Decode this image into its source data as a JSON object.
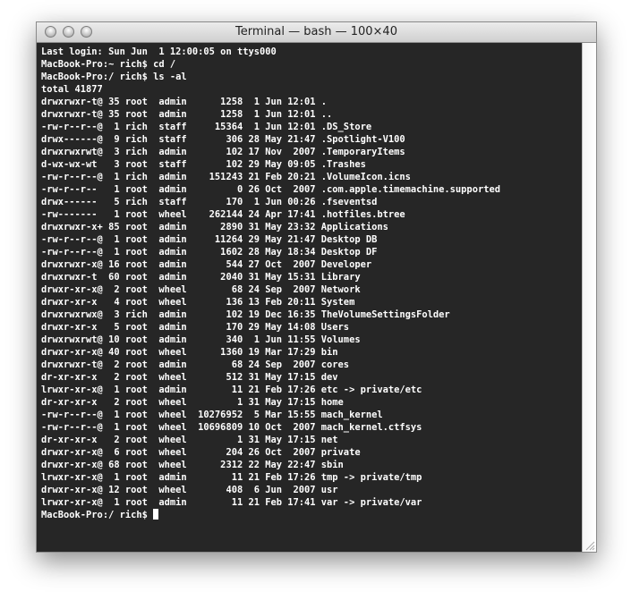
{
  "window": {
    "title": "Terminal — bash — 100×40"
  },
  "terminal": {
    "lines": [
      "Last login: Sun Jun  1 12:00:05 on ttys000",
      "MacBook-Pro:~ rich$ cd /",
      "MacBook-Pro:/ rich$ ls -al",
      "total 41877",
      "drwxrwxr-t@ 35 root  admin      1258  1 Jun 12:01 .",
      "drwxrwxr-t@ 35 root  admin      1258  1 Jun 12:01 ..",
      "-rw-r--r--@  1 rich  staff     15364  1 Jun 12:01 .DS_Store",
      "drwx------@  9 rich  staff       306 28 May 21:47 .Spotlight-V100",
      "drwxrwxrwt@  3 rich  admin       102 17 Nov  2007 .TemporaryItems",
      "d-wx-wx-wt   3 root  staff       102 29 May 09:05 .Trashes",
      "-rw-r--r--@  1 rich  admin    151243 21 Feb 20:21 .VolumeIcon.icns",
      "-rw-r--r--   1 root  admin         0 26 Oct  2007 .com.apple.timemachine.supported",
      "drwx------   5 rich  staff       170  1 Jun 00:26 .fseventsd",
      "-rw-------   1 root  wheel    262144 24 Apr 17:41 .hotfiles.btree",
      "drwxrwxr-x+ 85 root  admin      2890 31 May 23:32 Applications",
      "-rw-r--r--@  1 root  admin     11264 29 May 21:47 Desktop DB",
      "-rw-r--r--@  1 root  admin      1602 28 May 18:34 Desktop DF",
      "drwxrwxr-x@ 16 root  admin       544 27 Oct  2007 Developer",
      "drwxrwxr-t  60 root  admin      2040 31 May 15:31 Library",
      "drwxr-xr-x@  2 root  wheel        68 24 Sep  2007 Network",
      "drwxr-xr-x   4 root  wheel       136 13 Feb 20:11 System",
      "drwxrwxrwx@  3 rich  admin       102 19 Dec 16:35 TheVolumeSettingsFolder",
      "drwxr-xr-x   5 root  admin       170 29 May 14:08 Users",
      "drwxrwxrwt@ 10 root  admin       340  1 Jun 11:55 Volumes",
      "drwxr-xr-x@ 40 root  wheel      1360 19 Mar 17:29 bin",
      "drwxrwxr-t@  2 root  admin        68 24 Sep  2007 cores",
      "dr-xr-xr-x   2 root  wheel       512 31 May 17:15 dev",
      "lrwxr-xr-x@  1 root  admin        11 21 Feb 17:26 etc -> private/etc",
      "dr-xr-xr-x   2 root  wheel         1 31 May 17:15 home",
      "-rw-r--r--@  1 root  wheel  10276952  5 Mar 15:55 mach_kernel",
      "-rw-r--r--@  1 root  wheel  10696809 10 Oct  2007 mach_kernel.ctfsys",
      "dr-xr-xr-x   2 root  wheel         1 31 May 17:15 net",
      "drwxr-xr-x@  6 root  wheel       204 26 Oct  2007 private",
      "drwxr-xr-x@ 68 root  wheel      2312 22 May 22:47 sbin",
      "lrwxr-xr-x@  1 root  admin        11 21 Feb 17:26 tmp -> private/tmp",
      "drwxr-xr-x@ 12 root  wheel       408  6 Jun  2007 usr",
      "lrwxr-xr-x@  1 root  admin        11 21 Feb 17:41 var -> private/var"
    ],
    "prompt": "MacBook-Pro:/ rich$ "
  },
  "colors": {
    "background": "#262626",
    "foreground": "#ffffff"
  }
}
